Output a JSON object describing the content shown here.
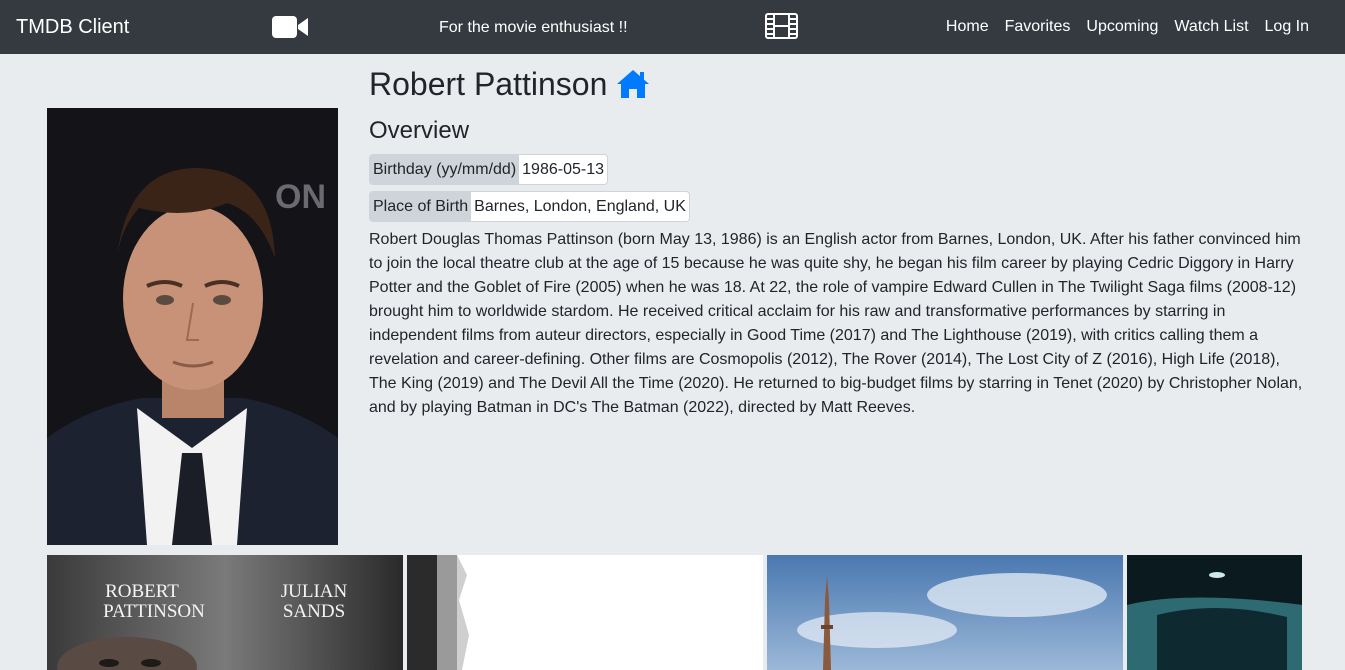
{
  "navbar": {
    "brand": "TMDB Client",
    "tagline": "For the movie enthusiast !!",
    "links": [
      "Home",
      "Favorites",
      "Upcoming",
      "Watch List",
      "Log In"
    ],
    "icons": {
      "left": "video-camera-icon",
      "center": "film-icon"
    }
  },
  "person": {
    "name": "Robert Pattinson",
    "overview_heading": "Overview",
    "birthday_label": "Birthday (yy/mm/dd)",
    "birthday": "1986-05-13",
    "birthplace_label": "Place of Birth",
    "birthplace": "Barnes, London, England, UK",
    "biography": "Robert Douglas Thomas Pattinson (born May 13, 1986) is an English actor from Barnes, London, UK. After his father convinced him to join the local theatre club at the age of 15 because he was quite shy, he began his film career by playing Cedric Diggory in Harry Potter and the Goblet of Fire (2005) when he was 18. At 22, the role of vampire Edward Cullen in The Twilight Saga films (2008-12) brought him to worldwide stardom. He received critical acclaim for his raw and transformative performances by starring in independent films from auteur directors, especially in Good Time (2017) and The Lighthouse (2019), with critics calling them a revelation and career-defining. Other films are Cosmopolis (2012), The Rover (2014), The Lost City of Z (2016), High Life (2018), The King (2019) and The Devil All the Time (2020). He returned to big-budget films by starring in Tenet (2020) by Christopher Nolan, and by playing Batman in DC's The Batman (2022), directed by Matt Reeves."
  },
  "posters": [
    {
      "line1_left": "ROBERT",
      "line2_left": "PATTINSON",
      "line1_right": "JULIAN",
      "line2_right": "SANDS"
    },
    {},
    {},
    {}
  ],
  "colors": {
    "navbar": "#343a40",
    "background": "#e9ecef",
    "accent": "#007bff",
    "pill_label": "#ced4da"
  }
}
